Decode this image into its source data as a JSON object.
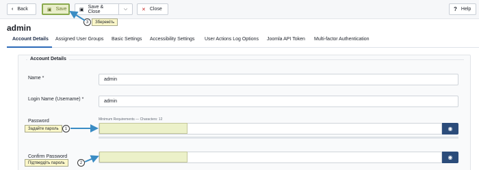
{
  "toolbar": {
    "back_label": "Back",
    "save_label": "Save",
    "save_close_label": "Save & Close",
    "close_label": "Close",
    "help_label": "Help"
  },
  "icons": {
    "back": "chevron-left-icon",
    "save": "floppy-icon",
    "save_close": "floppy-icon",
    "dropdown": "chevron-down-icon",
    "close": "times-icon",
    "help": "question-icon",
    "eye": "eye-icon"
  },
  "colors": {
    "accent": "#2a69b8",
    "eye_button": "#2b4c7a",
    "close_icon": "#c52827",
    "callout_bg": "#fbf7c9",
    "highlight_arrow": "#3a8cc4"
  },
  "page": {
    "title": "admin"
  },
  "tabs": [
    {
      "label": "Account Details",
      "active": true
    },
    {
      "label": "Assigned User Groups"
    },
    {
      "label": "Basic Settings"
    },
    {
      "label": "Accessibility Settings"
    },
    {
      "label": "User Actions Log Options"
    },
    {
      "label": "Joomla API Token"
    },
    {
      "label": "Multi-factor Authentication"
    }
  ],
  "form": {
    "legend": "Account Details",
    "name_label": "Name *",
    "name_value": "admin",
    "login_label": "Login Name (Username) *",
    "login_value": "admin",
    "password_label": "Password",
    "password_requirements": "Minimum Requirements — Characters: 12",
    "confirm_label": "Confirm Password"
  },
  "callouts": {
    "c1_number": "1",
    "c1_text": "Задайте пароль",
    "c2_number": "2",
    "c2_text": "Підтвердіть пароль",
    "c3_number": "3",
    "c3_text": "Збережіть"
  }
}
